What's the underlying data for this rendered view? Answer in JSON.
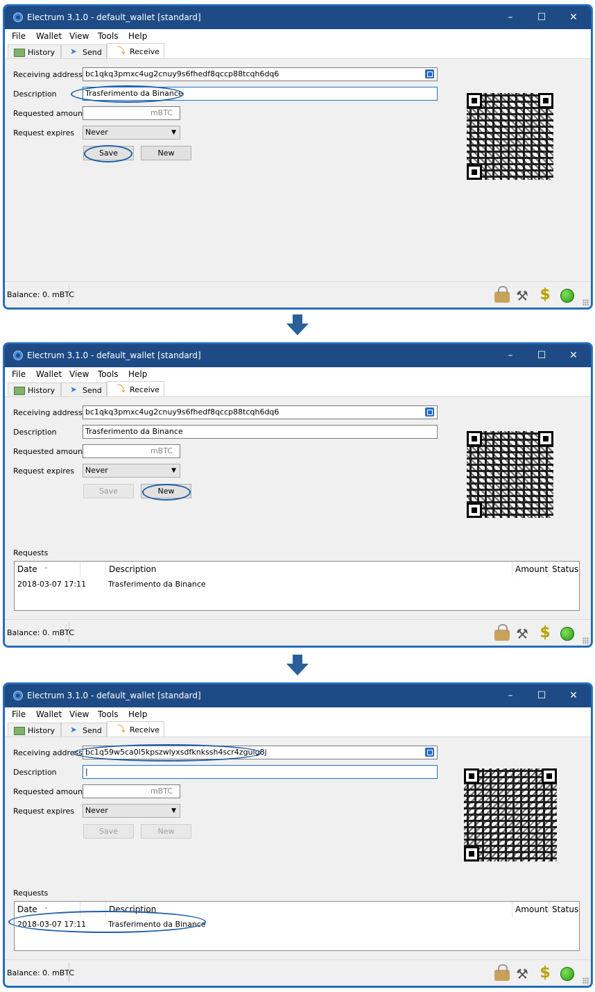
{
  "windows": [
    {
      "title": "Electrum 3.1.0  -  default_wallet  [standard]",
      "menu": [
        "File",
        "Wallet",
        "View",
        "Tools",
        "Help"
      ],
      "tabs": [
        "History",
        "Send",
        "Receive"
      ],
      "labels": {
        "receiving_address": "Receiving address",
        "description": "Description",
        "requested_amount": "Requested amount",
        "request_expires": "Request expires"
      },
      "receiving_address": "bc1qkq3pmxc4ug2cnuy9s6fhedf8qccp88tcqh6dq6",
      "description": "Trasferimento da Binance",
      "amount_unit": "mBTC",
      "expires": "Never",
      "save_label": "Save",
      "new_label": "New",
      "balance": "Balance: 0. mBTC"
    },
    {
      "title": "Electrum 3.1.0  -  default_wallet  [standard]",
      "menu": [
        "File",
        "Wallet",
        "View",
        "Tools",
        "Help"
      ],
      "tabs": [
        "History",
        "Send",
        "Receive"
      ],
      "labels": {
        "receiving_address": "Receiving address",
        "description": "Description",
        "requested_amount": "Requested amount",
        "request_expires": "Request expires"
      },
      "receiving_address": "bc1qkq3pmxc4ug2cnuy9s6fhedf8qccp88tcqh6dq6",
      "description": "Trasferimento da Binance",
      "amount_unit": "mBTC",
      "expires": "Never",
      "save_label": "Save",
      "new_label": "New",
      "requests_label": "Requests",
      "columns": [
        "Date",
        "Description",
        "Amount",
        "Status"
      ],
      "rows": [
        {
          "date": "2018-03-07 17:11",
          "description": "Trasferimento da Binance"
        }
      ],
      "balance": "Balance: 0. mBTC"
    },
    {
      "title": "Electrum 3.1.0  -  default_wallet  [standard]",
      "menu": [
        "File",
        "Wallet",
        "View",
        "Tools",
        "Help"
      ],
      "tabs": [
        "History",
        "Send",
        "Receive"
      ],
      "labels": {
        "receiving_address": "Receiving address",
        "description": "Description",
        "requested_amount": "Requested amount",
        "request_expires": "Request expires"
      },
      "receiving_address": "bc1q59w5ca0l5kpszwlyxsdfknkssh4scr4zgulg8j",
      "description": "",
      "amount_unit": "mBTC",
      "expires": "Never",
      "save_label": "Save",
      "new_label": "New",
      "requests_label": "Requests",
      "columns": [
        "Date",
        "Description",
        "Amount",
        "Status"
      ],
      "rows": [
        {
          "date": "2018-03-07 17:11",
          "description": "Trasferimento da Binance"
        }
      ],
      "balance": "Balance: 0. mBTC"
    }
  ],
  "colors": {
    "titlebar": "#1e4b85",
    "highlight": "#1d5ea8",
    "arrow": "#2a5f9a"
  }
}
